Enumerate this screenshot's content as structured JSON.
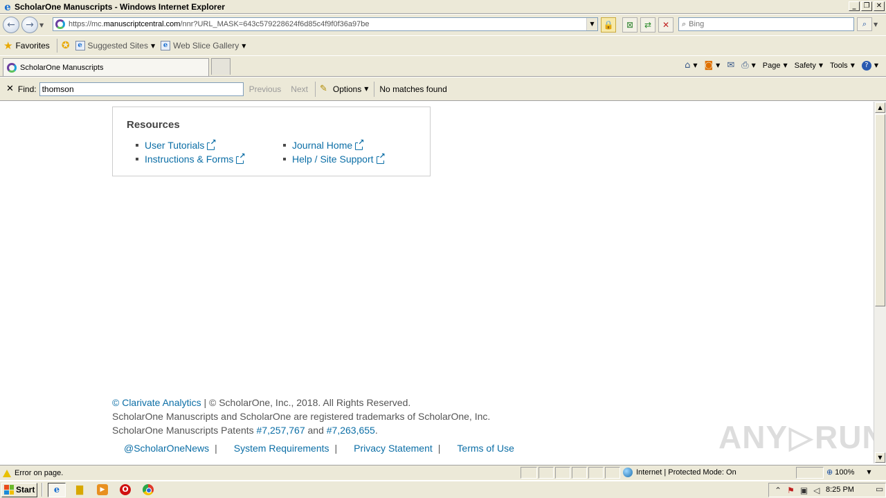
{
  "window": {
    "title": "ScholarOne Manuscripts - Windows Internet Explorer"
  },
  "address": {
    "url_prefix": "https://mc.",
    "url_domain": "manuscriptcentral.com",
    "url_path": "/nnr?URL_MASK=643c579228624f6d85c4f9f0f36a97be",
    "search_placeholder": "Bing"
  },
  "favorites": {
    "label": "Favorites",
    "links": [
      "Suggested Sites",
      "Web Slice Gallery"
    ]
  },
  "tab": {
    "label": "ScholarOne Manuscripts"
  },
  "commands": {
    "page": "Page",
    "safety": "Safety",
    "tools": "Tools"
  },
  "find": {
    "label": "Find:",
    "value": "thomson",
    "previous": "Previous",
    "next": "Next",
    "options": "Options",
    "status": "No matches found"
  },
  "resources": {
    "title": "Resources",
    "links": [
      "User Tutorials",
      "Instructions & Forms",
      "Journal Home",
      "Help / Site Support"
    ]
  },
  "footer": {
    "clarivate": "© Clarivate Analytics",
    "copyright": "© ScholarOne, Inc., 2018. All Rights Reserved.",
    "trademark": "ScholarOne Manuscripts and ScholarOne are registered trademarks of ScholarOne, Inc.",
    "patents_prefix": "ScholarOne Manuscripts Patents",
    "patent1": "#7,257,767",
    "patents_and": "and",
    "patent2": "#7,263,655",
    "links": [
      "@ScholarOneNews",
      "System Requirements",
      "Privacy Statement",
      "Terms of Use"
    ]
  },
  "watermark": {
    "left": "ANY",
    "right": "RUN"
  },
  "status": {
    "message": "Error on page.",
    "zone": "Internet | Protected Mode: On",
    "zoom": "100%"
  },
  "taskbar": {
    "start": "Start",
    "clock": "8:25 PM"
  }
}
